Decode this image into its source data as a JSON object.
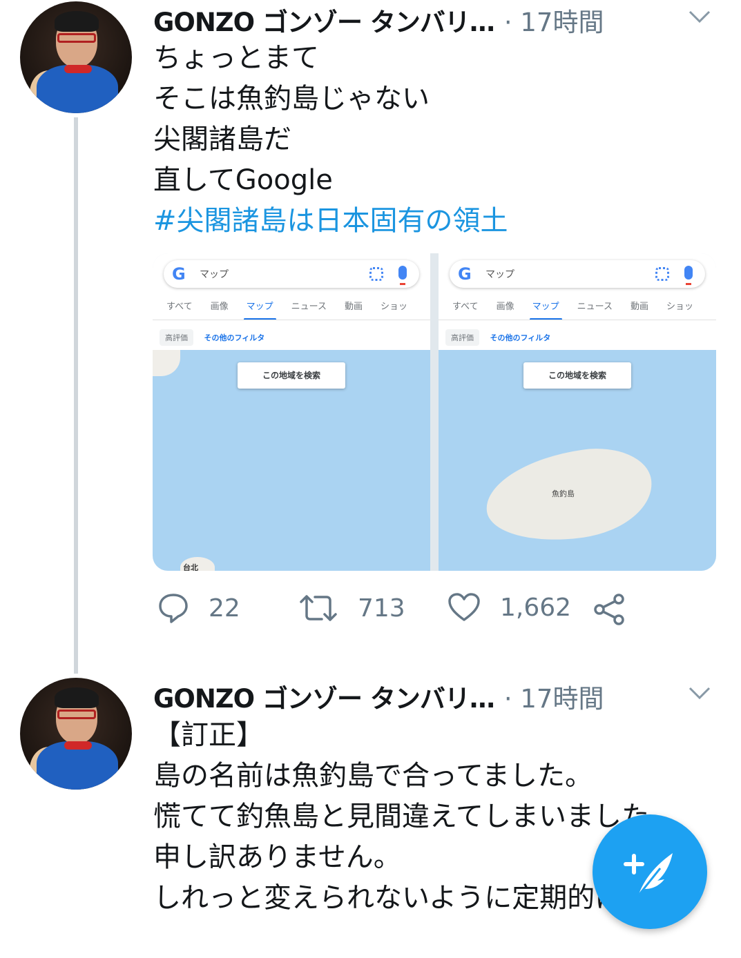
{
  "tweets": [
    {
      "author": "GONZO ゴンゾー タンバリ…",
      "meta": "· 17時間",
      "text_lines": [
        "ちょっとまて",
        "そこは魚釣島じゃない",
        "尖閣諸島だ",
        "直してGoogle"
      ],
      "hashtag": "#尖閣諸島は日本固有の領土",
      "media": {
        "left": {
          "search_query": "マップ",
          "tabs": [
            "すべて",
            "画像",
            "マップ",
            "ニュース",
            "動画",
            "ショッ"
          ],
          "active_tab": "マップ",
          "chip_rating": "高評価",
          "chip_filters": "その他のフィルタ",
          "search_area_button": "この地域を検索",
          "place_label": "台北"
        },
        "right": {
          "search_query": "マップ",
          "tabs": [
            "すべて",
            "画像",
            "マップ",
            "ニュース",
            "動画",
            "ショッ"
          ],
          "active_tab": "マップ",
          "chip_rating": "高評価",
          "chip_filters": "その他のフィルタ",
          "search_area_button": "この地域を検索",
          "place_label": "魚釣島"
        }
      },
      "actions": {
        "replies": "22",
        "retweets": "713",
        "likes": "1,662"
      }
    },
    {
      "author": "GONZO ゴンゾー タンバリ…",
      "meta": "· 17時間",
      "text_lines": [
        "【訂正】",
        "島の名前は魚釣島で合ってました。",
        "慌てて釣魚島と見間違えてしまいました。",
        "申し訳ありません。",
        "しれっと変えられないように定期的に見"
      ]
    }
  ],
  "icons": {
    "reply": "reply-icon",
    "retweet": "retweet-icon",
    "like": "heart-icon",
    "share": "share-icon",
    "caret": "chevron-down-icon",
    "compose": "compose-tweet-icon"
  },
  "colors": {
    "link": "#1b95e0",
    "muted": "#657786",
    "fab": "#1da1f2",
    "map_water": "#aad3f2"
  }
}
